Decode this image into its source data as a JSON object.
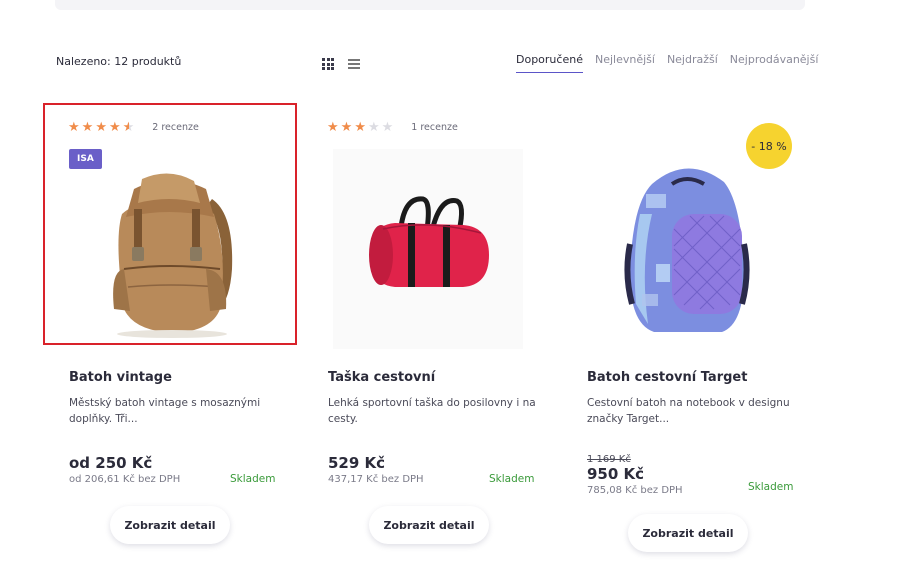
{
  "toolbar": {
    "found_text": "Nalezeno: 12 produktů",
    "sort_options": [
      "Doporučené",
      "Nejlevnější",
      "Nejdražší",
      "Nejprodávanější"
    ],
    "active_sort": "Doporučené",
    "view_modes": [
      "grid-icon",
      "list-icon"
    ]
  },
  "products": [
    {
      "rating": 4.5,
      "reviews": "2 recenze",
      "badge": "ISA",
      "discount": "",
      "name": "Batoh vintage",
      "description": "Městský batoh vintage s mosaznými doplňky. Tři...",
      "old_price": "",
      "price": "od 250 Kč",
      "price_net": "od 206,61 Kč bez DPH",
      "stock": "Skladem",
      "button": "Zobrazit detail"
    },
    {
      "rating": 3,
      "reviews": "1 recenze",
      "badge": "",
      "discount": "",
      "name": "Taška cestovní",
      "description": "Lehká sportovní taška do posilovny i na cesty.",
      "old_price": "",
      "price": "529 Kč",
      "price_net": "437,17 Kč bez DPH",
      "stock": "Skladem",
      "button": "Zobrazit detail"
    },
    {
      "rating": 0,
      "reviews": "",
      "badge": "",
      "discount": "- 18 %",
      "name": "Batoh cestovní Target",
      "description": "Cestovní batoh na notebook v designu značky Target...",
      "old_price": "1 169 Kč",
      "price": "950 Kč",
      "price_net": "785,08 Kč bez DPH",
      "stock": "Skladem",
      "button": "Zobrazit detail"
    }
  ],
  "colors": {
    "accent": "#5b55c8",
    "star": "#f08c4a",
    "badge": "#6a5fc8",
    "discount": "#f6d32f",
    "stock": "#3a9a3a",
    "highlight": "#d9222a"
  }
}
